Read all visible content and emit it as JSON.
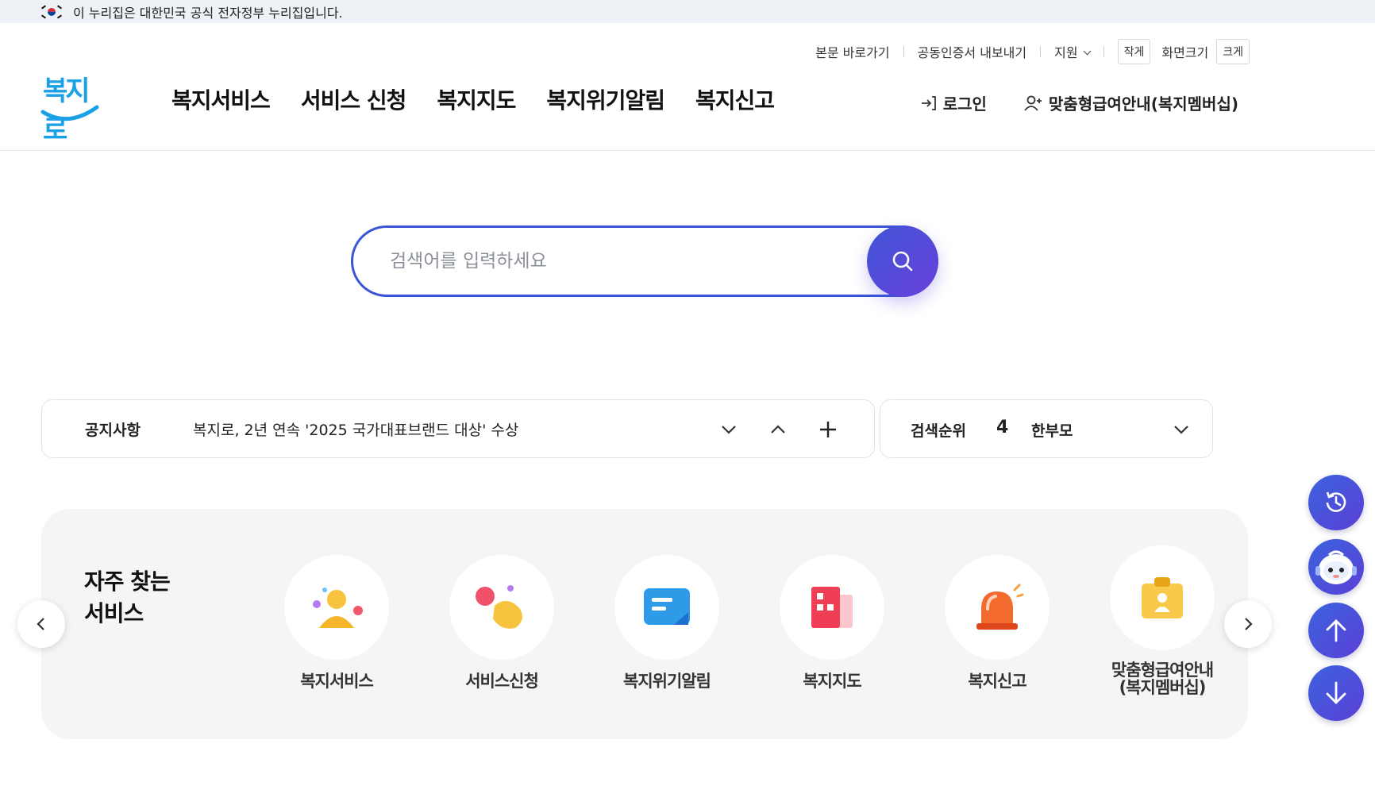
{
  "gov_banner": {
    "text": "이 누리집은 대한민국 공식 전자정부 누리집입니다."
  },
  "util_links": {
    "skip": "본문 바로가기",
    "cert": "공동인증서 내보내기",
    "support": "지원",
    "small": "작게",
    "screen_size": "화면크기",
    "large": "크게"
  },
  "logo": {
    "text": "복지로"
  },
  "gnb": [
    "복지서비스",
    "서비스 신청",
    "복지지도",
    "복지위기알림",
    "복지신고"
  ],
  "header_actions": {
    "login": "로그인",
    "membership": "맞춤형급여안내(복지멤버십)"
  },
  "search": {
    "placeholder": "검색어를 입력하세요"
  },
  "notice": {
    "label": "공지사항",
    "text": "복지로, 2년 연속 '2025 국가대표브랜드 대상' 수상"
  },
  "search_rank": {
    "label": "검색순위",
    "rank": "4",
    "keyword": "한부모"
  },
  "quick_services": {
    "title_line1": "자주 찾는",
    "title_line2": "서비스",
    "items": [
      "복지서비스",
      "서비스신청",
      "복지위기알림",
      "복지지도",
      "복지신고",
      "맞춤형급여안내",
      "(복지멤버십)"
    ]
  },
  "icons": {
    "recent": "history-icon",
    "chatbot": "chatbot-icon",
    "top": "arrow-up-icon",
    "bottom": "arrow-down-icon"
  },
  "colors": {
    "brand": "#1aa0e6",
    "accent": "#3a56d6",
    "accent2": "#6a3fdb"
  }
}
